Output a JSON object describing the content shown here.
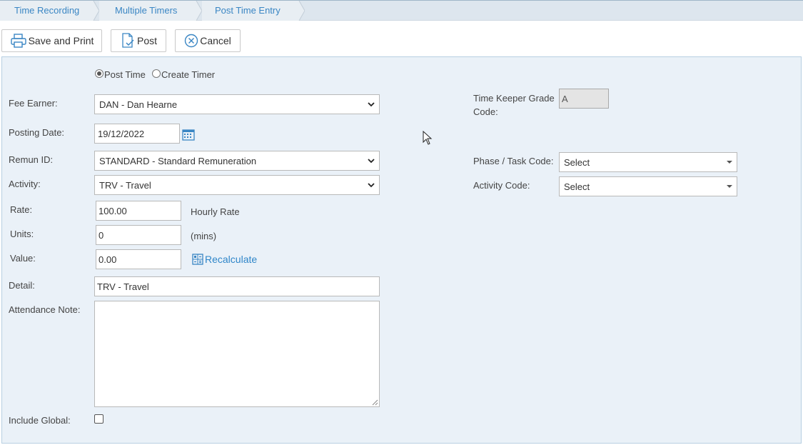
{
  "breadcrumb": {
    "items": [
      "Time Recording",
      "Multiple Timers",
      "Post Time Entry"
    ]
  },
  "toolbar": {
    "save_print_label": "Save and Print",
    "post_label": "Post",
    "cancel_label": "Cancel"
  },
  "mode": {
    "post_time_label": "Post Time",
    "create_timer_label": "Create Timer",
    "selected": "Post Time"
  },
  "form": {
    "fee_earner_label": "Fee Earner:",
    "fee_earner_value": "DAN - Dan Hearne",
    "posting_date_label": "Posting Date:",
    "posting_date_value": "19/12/2022",
    "remun_id_label": "Remun ID:",
    "remun_id_value": "STANDARD - Standard Remuneration",
    "activity_label": "Activity:",
    "activity_value": "TRV - Travel",
    "rate_label": "Rate:",
    "rate_value": "100.00",
    "rate_unit": "Hourly Rate",
    "units_label": "Units:",
    "units_value": "0",
    "units_unit": "(mins)",
    "value_label": "Value:",
    "value_value": "0.00",
    "recalculate_label": "Recalculate",
    "detail_label": "Detail:",
    "detail_value": "TRV - Travel",
    "attendance_note_label": "Attendance Note:",
    "attendance_note_value": "",
    "include_global_label": "Include Global:",
    "include_global_checked": false,
    "time_keeper_grade_label_line1": "Time Keeper Grade",
    "time_keeper_grade_label_line2": "Code:",
    "time_keeper_grade_value": "A",
    "phase_task_label": "Phase / Task Code:",
    "phase_task_value": "Select",
    "activity_code_label": "Activity Code:",
    "activity_code_value": "Select"
  },
  "colors": {
    "accent": "#2f86c9",
    "panel_bg": "#eaf1f8",
    "breadcrumb_bg": "#dde6ee"
  }
}
